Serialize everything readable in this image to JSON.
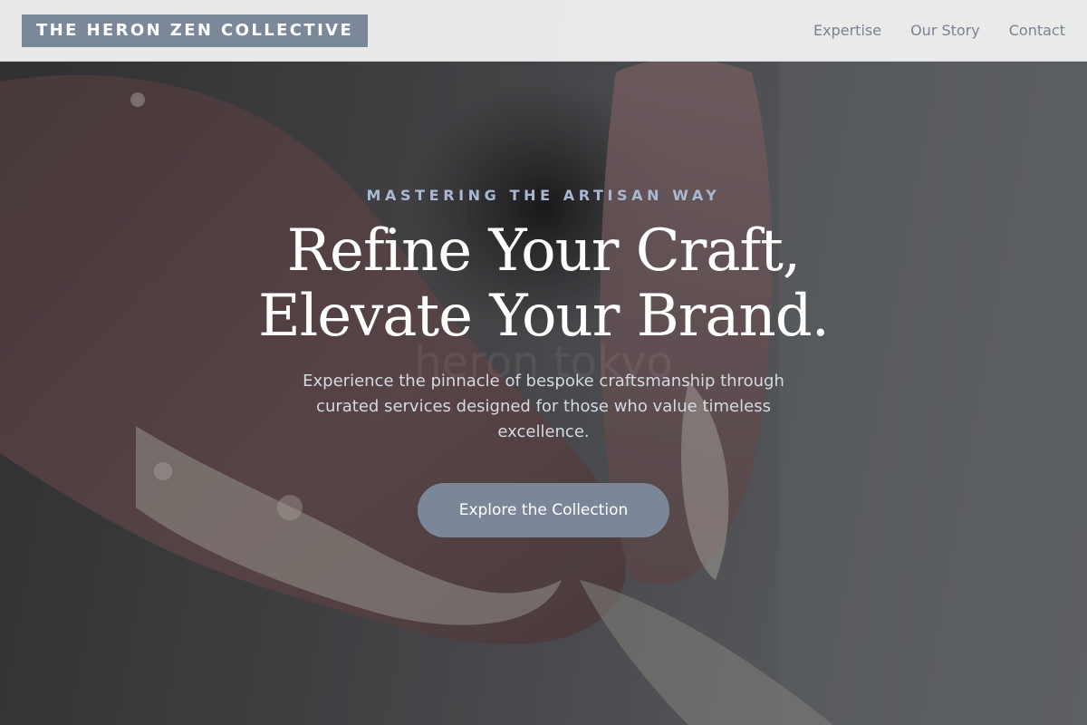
{
  "header": {
    "logo_text": "THE HERON ZEN COLLECTIVE",
    "nav": [
      {
        "label": "Expertise"
      },
      {
        "label": "Our Story"
      },
      {
        "label": "Contact"
      }
    ]
  },
  "hero": {
    "eyebrow": "MASTERING THE ARTISAN WAY",
    "headline_line1": "Refine Your Craft,",
    "headline_line2": "Elevate Your Brand.",
    "background_watermark": "heron tokyo",
    "subtitle": "Experience the pinnacle of bespoke craftsmanship through curated services designed for those who value timeless excellence.",
    "cta_label": "Explore the Collection"
  },
  "colors": {
    "accent": "#7b8899",
    "eyebrow": "#a9b9d2",
    "nav_text": "#7a8290",
    "header_bg": "#f0f0f0"
  }
}
